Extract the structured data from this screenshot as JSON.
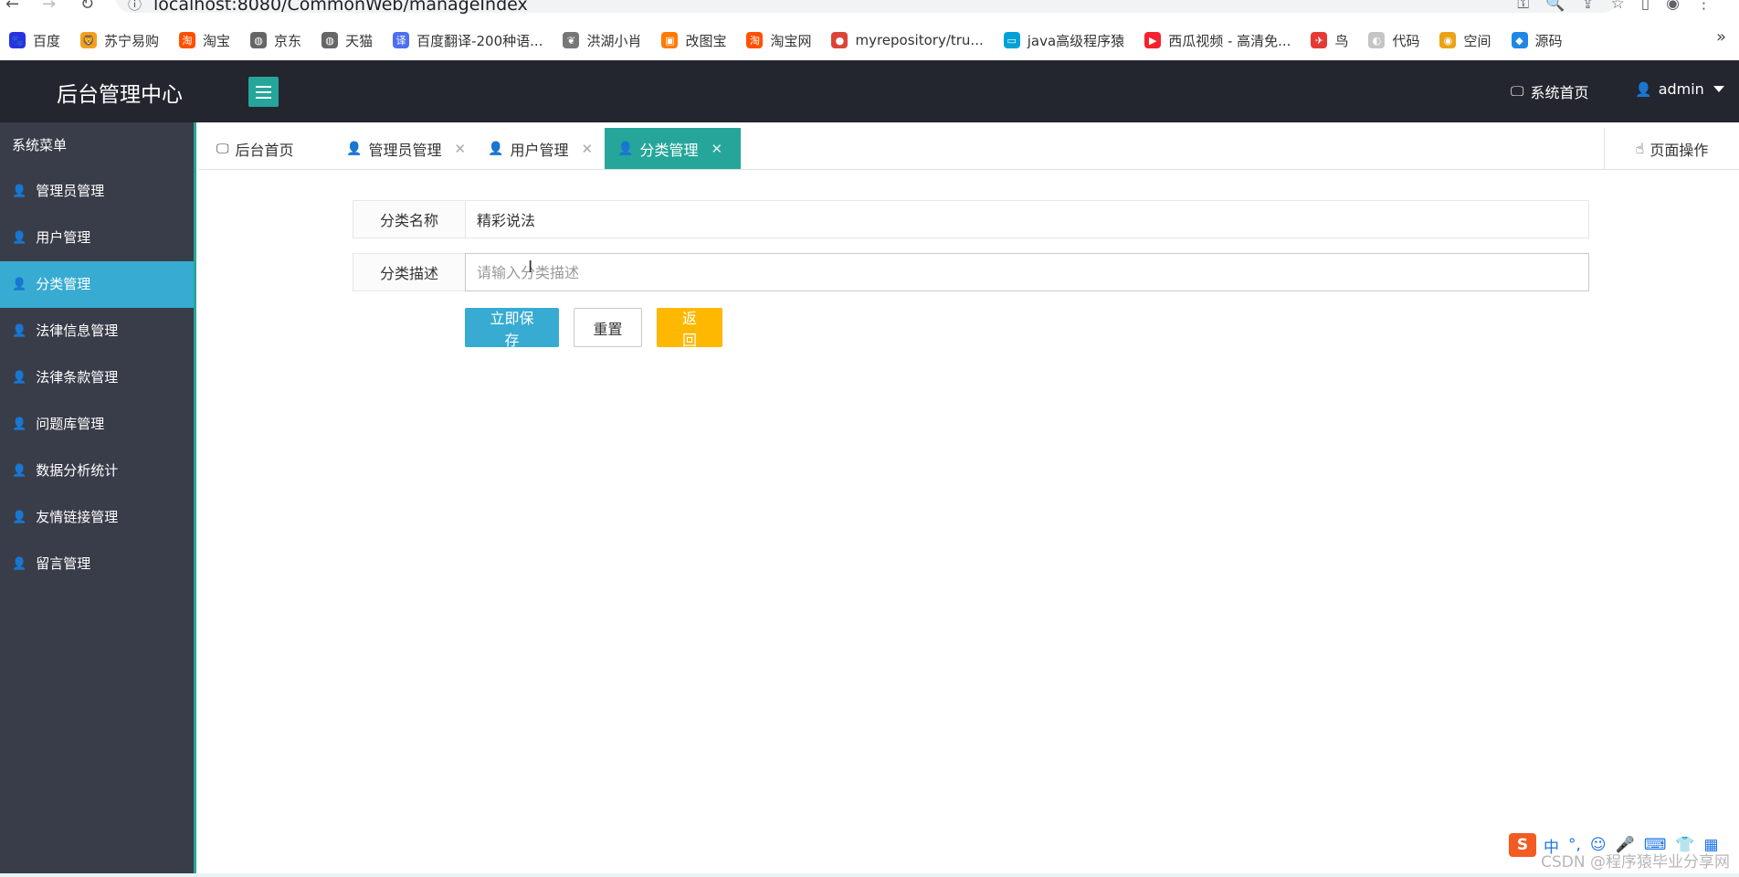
{
  "browser": {
    "url": "localhost:8080/CommonWeb/manageIndex",
    "bookmarks": [
      {
        "label": "百度",
        "icon": "baidu-icon",
        "color": "#2932e1",
        "glyph": "🐾"
      },
      {
        "label": "苏宁易购",
        "icon": "suning-icon",
        "color": "#f0a21f",
        "glyph": "🦁"
      },
      {
        "label": "淘宝",
        "icon": "taobao-icon",
        "color": "#ff5000",
        "glyph": "淘"
      },
      {
        "label": "京东",
        "icon": "globe-icon",
        "color": "#666666",
        "glyph": "◍"
      },
      {
        "label": "天猫",
        "icon": "globe-icon",
        "color": "#666666",
        "glyph": "◍"
      },
      {
        "label": "百度翻译-200种语...",
        "icon": "translate-icon",
        "color": "#4e6ef2",
        "glyph": "译"
      },
      {
        "label": "洪湖小肖",
        "icon": "bird-icon",
        "color": "#777777",
        "glyph": "❦"
      },
      {
        "label": "改图宝",
        "icon": "gaitubao-icon",
        "color": "#ff7a00",
        "glyph": "▣"
      },
      {
        "label": "淘宝网",
        "icon": "taobao-icon",
        "color": "#ff5000",
        "glyph": "淘"
      },
      {
        "label": "myrepository/tru...",
        "icon": "chrome-icon",
        "color": "#db4437",
        "glyph": "●"
      },
      {
        "label": "java高级程序猿",
        "icon": "bilibili-icon",
        "color": "#00a1d6",
        "glyph": "▭"
      },
      {
        "label": "西瓜视频 - 高清免...",
        "icon": "xigua-icon",
        "color": "#f5222d",
        "glyph": "▶"
      },
      {
        "label": "鸟",
        "icon": "bird-icon",
        "color": "#e53935",
        "glyph": "✈"
      },
      {
        "label": "代码",
        "icon": "code-icon",
        "color": "#c5c5c5",
        "glyph": "◐"
      },
      {
        "label": "空间",
        "icon": "qzone-icon",
        "color": "#e8a317",
        "glyph": "◉"
      },
      {
        "label": "源码",
        "icon": "fish-icon",
        "color": "#1e88e5",
        "glyph": "◆"
      }
    ],
    "more": "»"
  },
  "header": {
    "title": "后台管理中心",
    "system_home": "系统首页",
    "user": "admin"
  },
  "sidebar": {
    "title": "系统菜单",
    "items": [
      {
        "label": "管理员管理",
        "active": false
      },
      {
        "label": "用户管理",
        "active": false
      },
      {
        "label": "分类管理",
        "active": true
      },
      {
        "label": "法律信息管理",
        "active": false
      },
      {
        "label": "法律条款管理",
        "active": false
      },
      {
        "label": "问题库管理",
        "active": false
      },
      {
        "label": "数据分析统计",
        "active": false
      },
      {
        "label": "友情链接管理",
        "active": false
      },
      {
        "label": "留言管理",
        "active": false
      }
    ]
  },
  "tabs": {
    "items": [
      {
        "label": "后台首页",
        "icon": "monitor-icon",
        "closable": false,
        "active": false
      },
      {
        "label": "管理员管理",
        "icon": "user-icon",
        "closable": true,
        "active": false
      },
      {
        "label": "用户管理",
        "icon": "user-icon",
        "closable": true,
        "active": false
      },
      {
        "label": "分类管理",
        "icon": "user-icon",
        "closable": true,
        "active": true
      }
    ],
    "page_ops": "页面操作"
  },
  "form": {
    "name_label": "分类名称",
    "name_value": "精彩说法",
    "desc_label": "分类描述",
    "desc_value": "",
    "desc_placeholder": "请输入分类描述",
    "save": "立即保存",
    "reset": "重置",
    "back": "返回"
  },
  "overlay": {
    "watermark": "CSDN @程序猿毕业分享网",
    "ime_lang": "中"
  },
  "colors": {
    "header_bg": "#23262e",
    "sidebar_bg": "#393d49",
    "accent_teal": "#26a69a",
    "active_blue": "#37abd2",
    "warn_yellow": "#ffb800"
  }
}
